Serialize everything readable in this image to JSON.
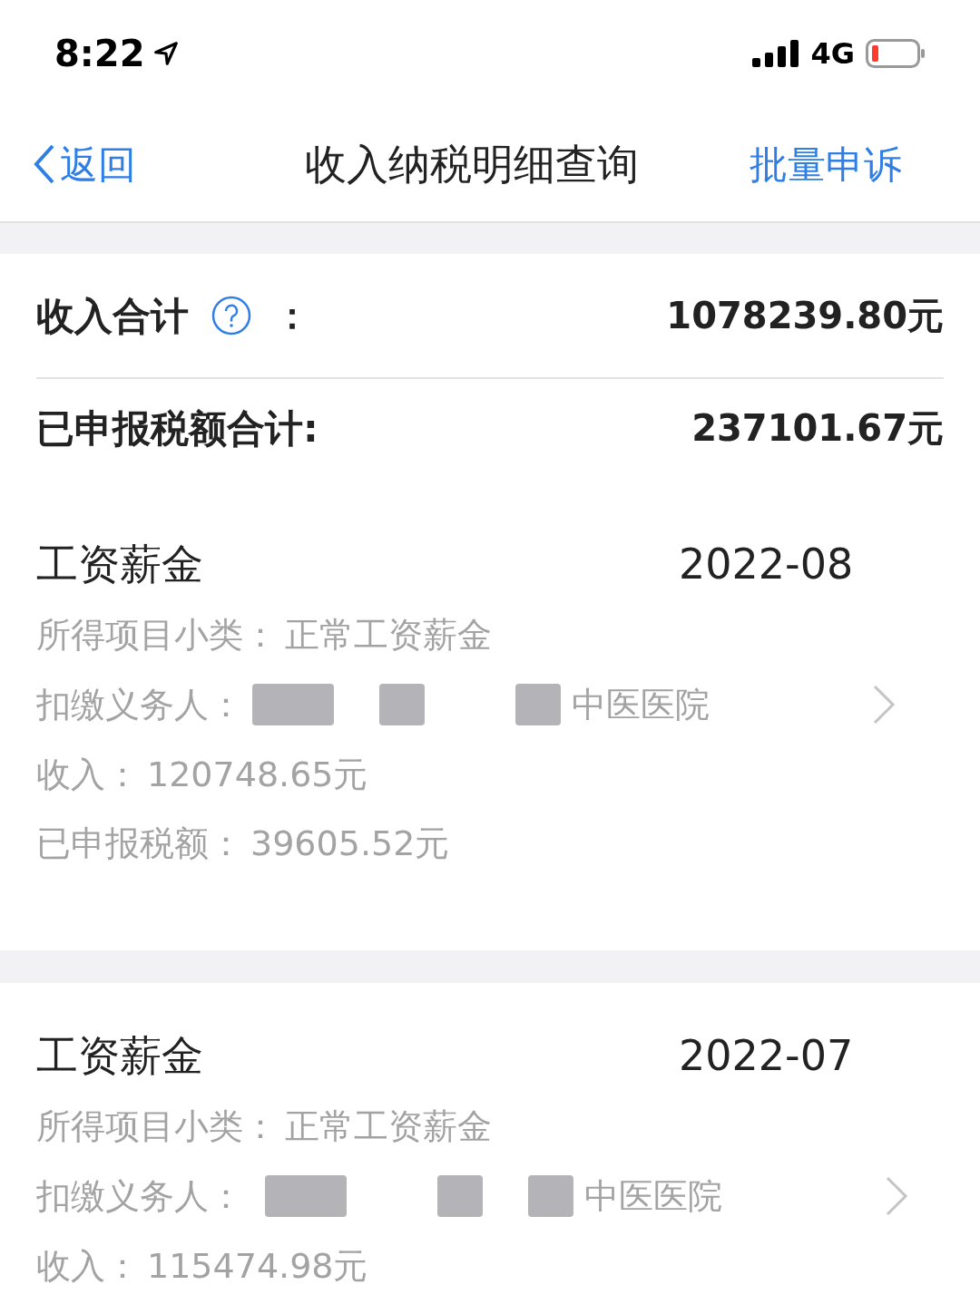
{
  "status_bar": {
    "time": "8:22",
    "network": "4G"
  },
  "nav": {
    "back": "返回",
    "title": "收入纳税明细查询",
    "action": "批量申诉"
  },
  "summary": [
    {
      "label": "收入合计",
      "help": true,
      "colon": "：",
      "value": "1078239.80元"
    },
    {
      "label": "已申报税额合计:",
      "help": false,
      "value": "237101.67元"
    }
  ],
  "records": [
    {
      "type": "工资薪金",
      "period": "2022-08",
      "subcategory_label": "所得项目小类：",
      "subcategory": "正常工资薪金",
      "payer_label": "扣缴义务人：",
      "payer_visible": "中医医院",
      "income_label": "收入：",
      "income": "120748.65元",
      "tax_label": "已申报税额：",
      "tax": "39605.52元"
    },
    {
      "type": "工资薪金",
      "period": "2022-07",
      "subcategory_label": "所得项目小类：",
      "subcategory": "正常工资薪金",
      "payer_label": "扣缴义务人：",
      "payer_visible": "中医医院",
      "income_label": "收入：",
      "income": "115474.98元"
    }
  ]
}
